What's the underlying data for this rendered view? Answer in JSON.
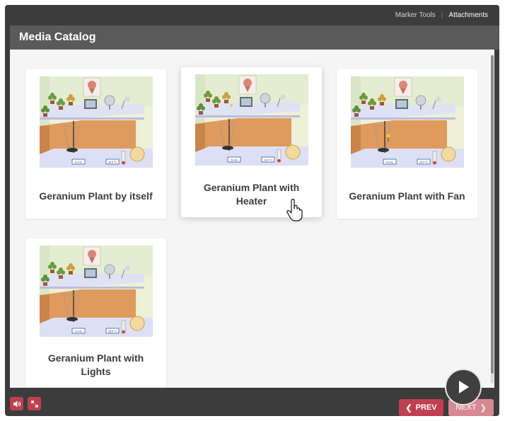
{
  "topbar": {
    "marker_tools": "Marker Tools",
    "separator": "|",
    "attachments": "Attachments"
  },
  "header": {
    "title": "Media Catalog"
  },
  "cards": [
    {
      "label": "Geranium Plant by itself",
      "variant": "none",
      "thumb_readout_left": "0.0 mL",
      "thumb_readout_right": "23.0 °C"
    },
    {
      "label": "Geranium Plant with Heater",
      "variant": "heater",
      "thumb_readout_left": "0.0 mL",
      "thumb_readout_right": "23.0 °C"
    },
    {
      "label": "Geranium Plant with Fan",
      "variant": "fan",
      "thumb_readout_left": "0.0 mL",
      "thumb_readout_right": "23.0 °C"
    },
    {
      "label": "Geranium Plant with Lights",
      "variant": "lights",
      "thumb_readout_left": "0.0 mL",
      "thumb_readout_right": "23.0 °C"
    }
  ],
  "controls": {
    "sound_icon": "speaker-icon",
    "fullscreen_icon": "expand-icon",
    "prev_label": "PREV",
    "next_label": "NEXT",
    "play_icon": "play-icon"
  },
  "colors": {
    "frame": "#3c3c3c",
    "titlebar": "#5a5a5a",
    "accent": "#c0404f",
    "accent_disabled": "#d68893",
    "content_bg": "#f5f5f5"
  }
}
